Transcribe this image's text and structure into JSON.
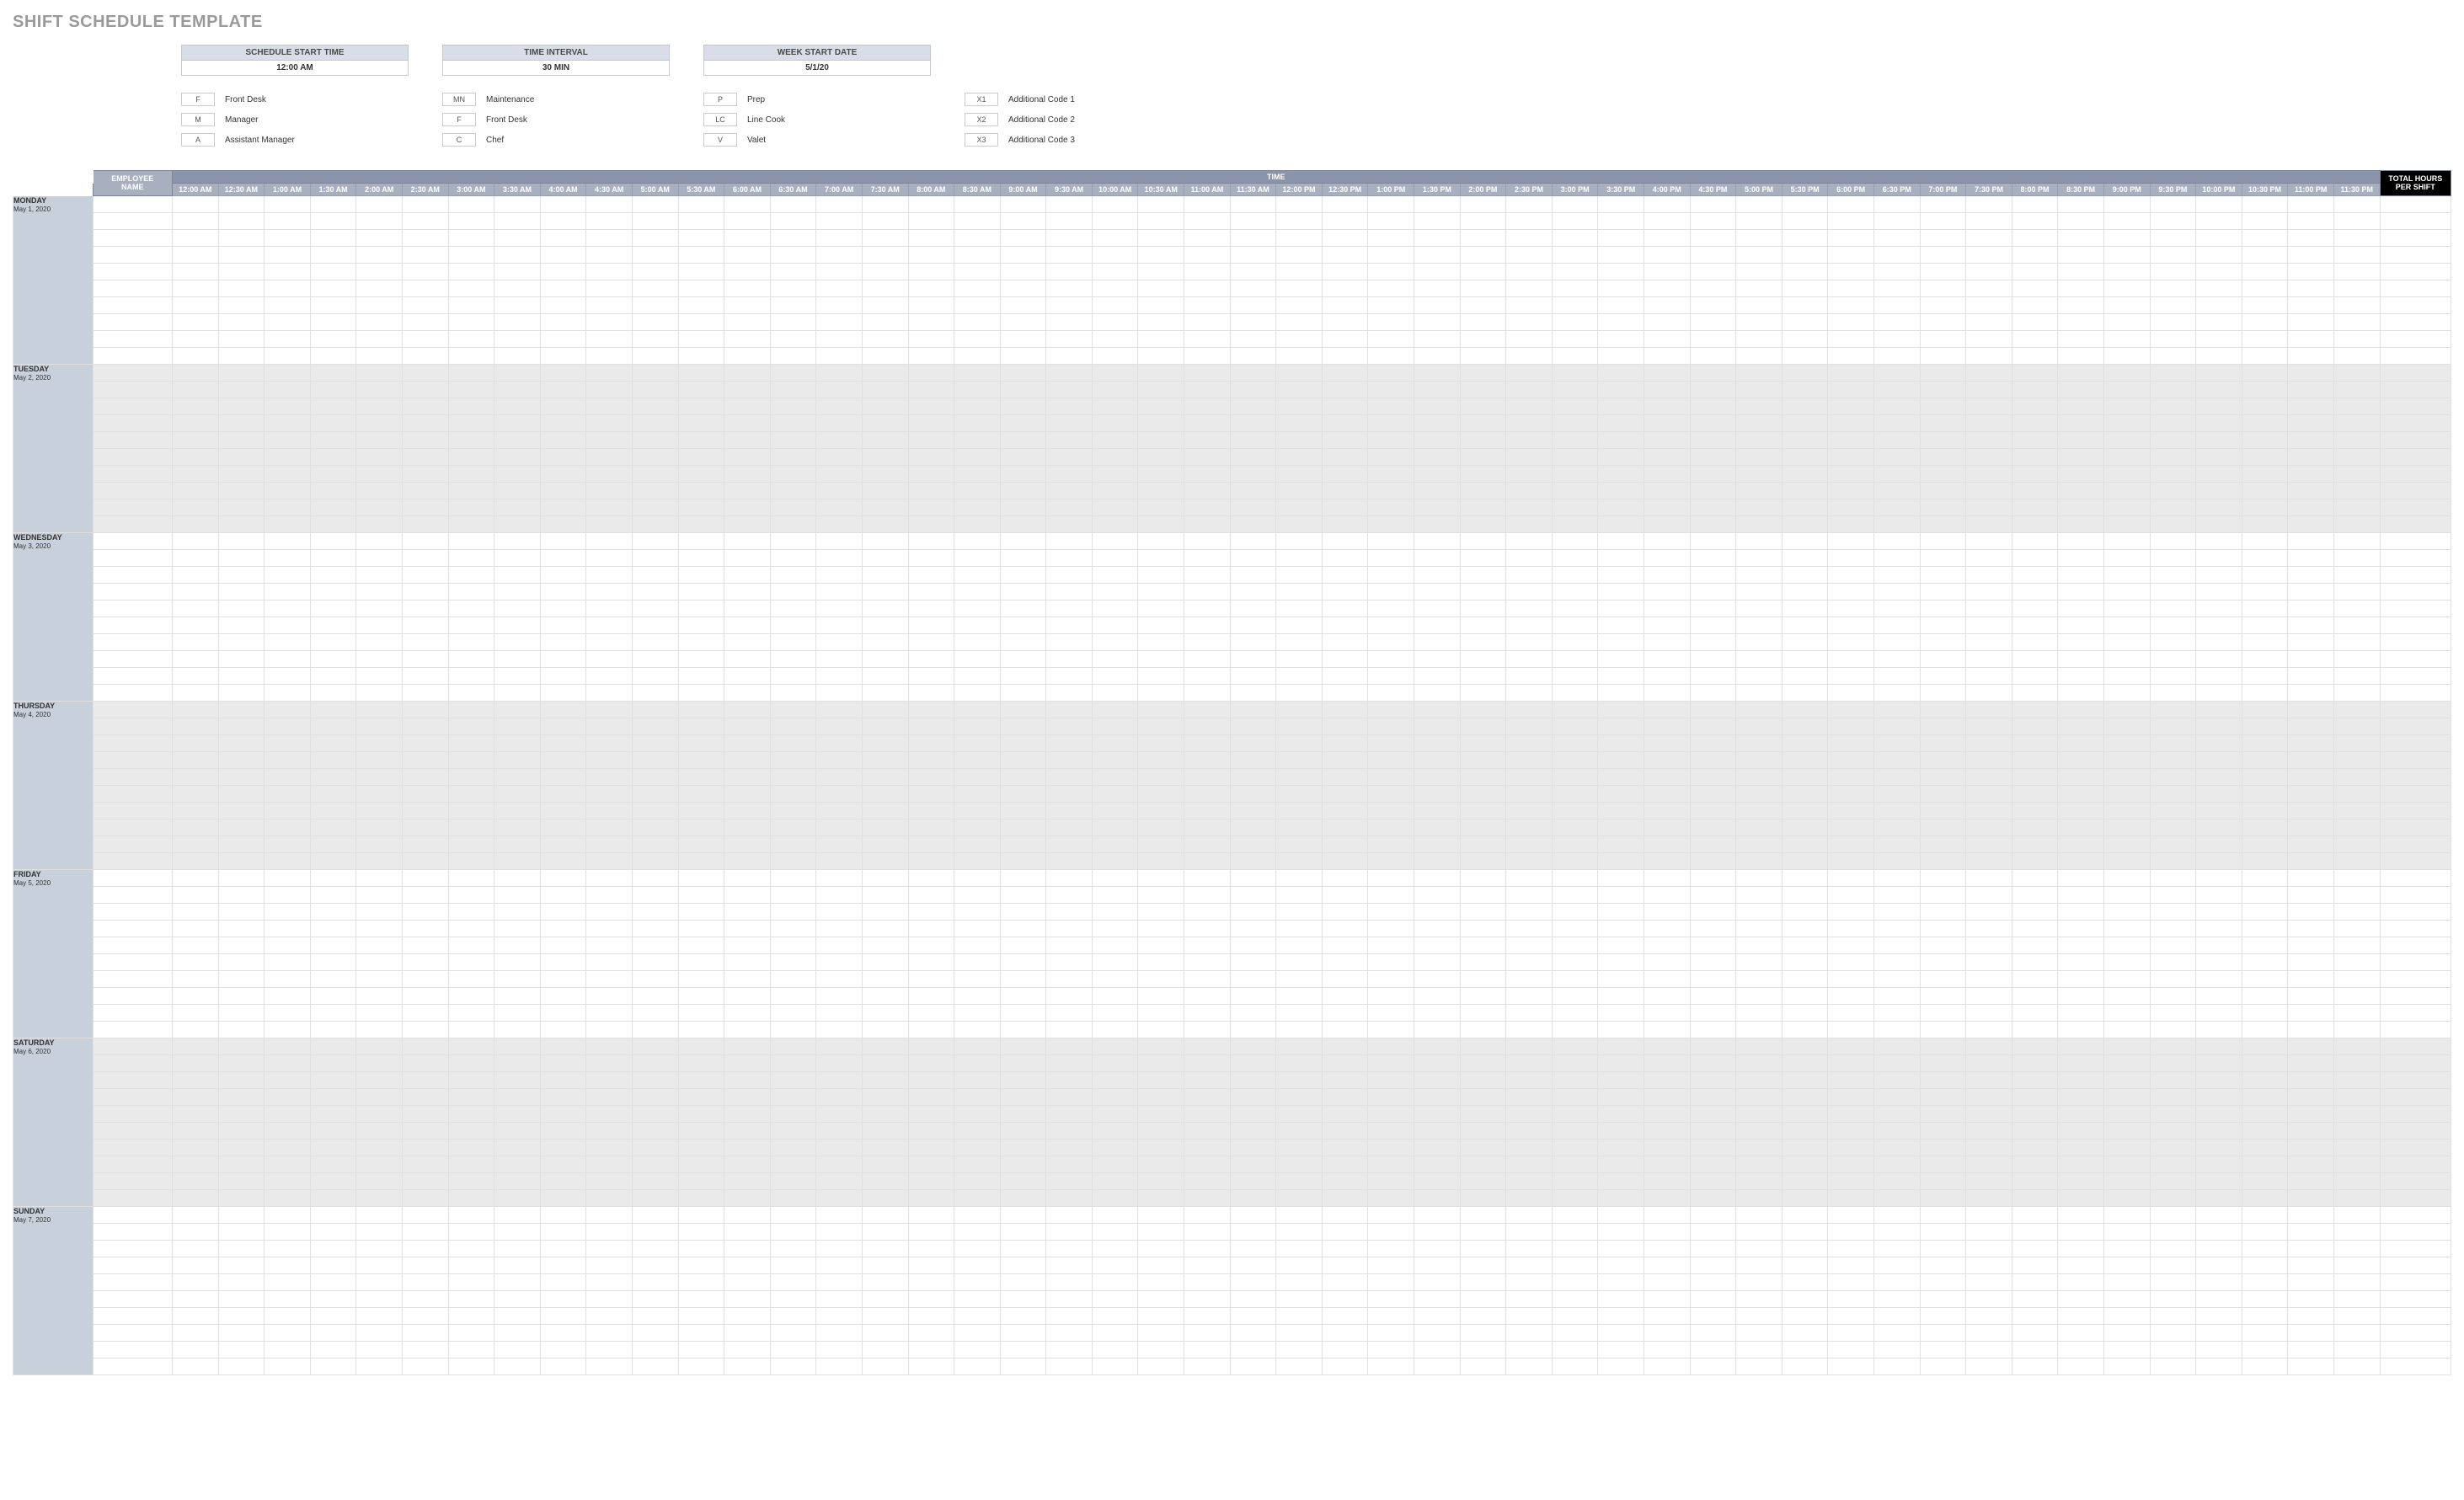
{
  "title": "SHIFT SCHEDULE TEMPLATE",
  "config": {
    "start_time_label": "SCHEDULE START TIME",
    "start_time_value": "12:00 AM",
    "interval_label": "TIME INTERVAL",
    "interval_value": "30 MIN",
    "week_start_label": "WEEK START DATE",
    "week_start_value": "5/1/20"
  },
  "legend": {
    "col1": [
      {
        "code": "F",
        "label": "Front Desk"
      },
      {
        "code": "M",
        "label": "Manager"
      },
      {
        "code": "A",
        "label": "Assistant Manager"
      }
    ],
    "col2": [
      {
        "code": "MN",
        "label": "Maintenance"
      },
      {
        "code": "F",
        "label": "Front Desk"
      },
      {
        "code": "C",
        "label": "Chef"
      }
    ],
    "col3": [
      {
        "code": "P",
        "label": "Prep"
      },
      {
        "code": "LC",
        "label": "Line Cook"
      },
      {
        "code": "V",
        "label": "Valet"
      }
    ],
    "col4": [
      {
        "code": "X1",
        "label": "Additional Code 1"
      },
      {
        "code": "X2",
        "label": "Additional Code 2"
      },
      {
        "code": "X3",
        "label": "Additional Code 3"
      }
    ]
  },
  "headers": {
    "time_label": "TIME",
    "employee_top": "EMPLOYEE",
    "employee_bottom": "NAME",
    "total_hours_top": "TOTAL HOURS",
    "total_hours_bottom": "PER SHIFT",
    "time_slots": [
      "12:00 AM",
      "12:30 AM",
      "1:00 AM",
      "1:30 AM",
      "2:00 AM",
      "2:30 AM",
      "3:00 AM",
      "3:30 AM",
      "4:00 AM",
      "4:30 AM",
      "5:00 AM",
      "5:30 AM",
      "6:00 AM",
      "6:30 AM",
      "7:00 AM",
      "7:30 AM",
      "8:00 AM",
      "8:30 AM",
      "9:00 AM",
      "9:30 AM",
      "10:00 AM",
      "10:30 AM",
      "11:00 AM",
      "11:30 AM",
      "12:00 PM",
      "12:30 PM",
      "1:00 PM",
      "1:30 PM",
      "2:00 PM",
      "2:30 PM",
      "3:00 PM",
      "3:30 PM",
      "4:00 PM",
      "4:30 PM",
      "5:00 PM",
      "5:30 PM",
      "6:00 PM",
      "6:30 PM",
      "7:00 PM",
      "7:30 PM",
      "8:00 PM",
      "8:30 PM",
      "9:00 PM",
      "9:30 PM",
      "10:00 PM",
      "10:30 PM",
      "11:00 PM",
      "11:30 PM"
    ]
  },
  "days": [
    {
      "name": "MONDAY",
      "date": "May 1, 2020",
      "shade": "light"
    },
    {
      "name": "TUESDAY",
      "date": "May 2, 2020",
      "shade": "dark"
    },
    {
      "name": "WEDNESDAY",
      "date": "May 3, 2020",
      "shade": "light"
    },
    {
      "name": "THURSDAY",
      "date": "May 4, 2020",
      "shade": "dark"
    },
    {
      "name": "FRIDAY",
      "date": "May 5, 2020",
      "shade": "light"
    },
    {
      "name": "SATURDAY",
      "date": "May 6, 2020",
      "shade": "dark"
    },
    {
      "name": "SUNDAY",
      "date": "May 7, 2020",
      "shade": "light"
    }
  ],
  "rows_per_day": 10,
  "time_slot_count": 48
}
